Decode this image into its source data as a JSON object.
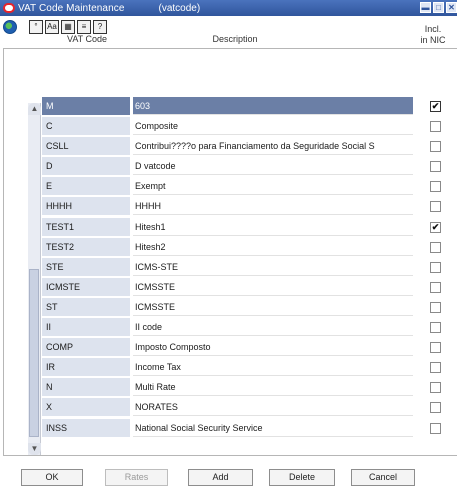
{
  "window": {
    "title": "VAT Code Maintenance",
    "code": "(vatcode)",
    "controls": [
      "minimize",
      "maximize",
      "close"
    ]
  },
  "toolbar": {
    "icons": [
      "globe-icon",
      "help-icon",
      "text-icon",
      "calendar-icon",
      "notes-icon",
      "info-icon"
    ],
    "glyphs": [
      "°",
      "Aa",
      "▦",
      "≡",
      "?"
    ]
  },
  "table": {
    "headers": {
      "code": "VAT Code",
      "description": "Description",
      "incl_line1": "Incl.",
      "incl_line2": "in NIC"
    },
    "rows": [
      {
        "code": "M",
        "description": "603",
        "incl": true,
        "selected": true
      },
      {
        "code": "C",
        "description": "Composite",
        "incl": false
      },
      {
        "code": "CSLL",
        "description": "Contribui????o para Financiamento da Seguridade Social  S",
        "incl": false
      },
      {
        "code": "D",
        "description": "D vatcode",
        "incl": false
      },
      {
        "code": "E",
        "description": "Exempt",
        "incl": false
      },
      {
        "code": "HHHH",
        "description": "HHHH",
        "incl": false
      },
      {
        "code": "TEST1",
        "description": "Hitesh1",
        "incl": true
      },
      {
        "code": "TEST2",
        "description": "Hitesh2",
        "incl": false
      },
      {
        "code": "STE",
        "description": "ICMS-STE",
        "incl": false
      },
      {
        "code": "ICMSTE",
        "description": "ICMSSTE",
        "incl": false
      },
      {
        "code": "ST",
        "description": "ICMSSTE",
        "incl": false
      },
      {
        "code": "II",
        "description": "II code",
        "incl": false
      },
      {
        "code": "COMP",
        "description": "Imposto Composto",
        "incl": false
      },
      {
        "code": "IR",
        "description": "Income Tax",
        "incl": false
      },
      {
        "code": "N",
        "description": "Multi Rate",
        "incl": false
      },
      {
        "code": "X",
        "description": "NORATES",
        "incl": false
      },
      {
        "code": "INSS",
        "description": "National Social Security Service",
        "incl": false
      }
    ]
  },
  "buttons": {
    "ok": "OK",
    "rates": "Rates",
    "add": "Add",
    "delete": "Delete",
    "cancel": "Cancel"
  },
  "colors": {
    "titlebar": "#30559c",
    "selected_row": "#6b7fa6",
    "code_cell": "#dde3ee"
  }
}
